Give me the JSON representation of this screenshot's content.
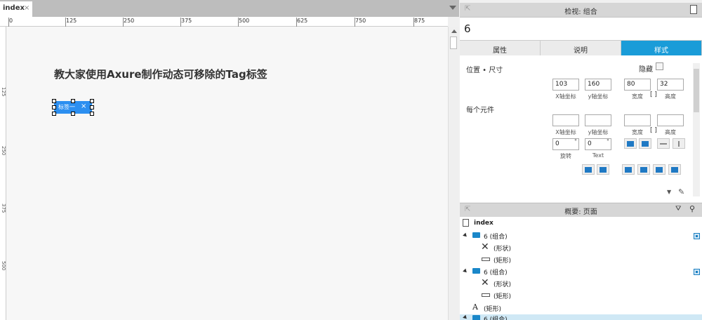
{
  "tab": {
    "name": "index",
    "close": "×"
  },
  "ruler": {
    "h_labels": [
      "0",
      "125",
      "250",
      "375",
      "500",
      "625",
      "750",
      "875"
    ],
    "v_labels": [
      "125",
      "250",
      "375",
      "500"
    ]
  },
  "canvas": {
    "heading": "教大家使用Axure制作动态可移除的Tag标签",
    "tag_label": "标签一",
    "tag_close": "×"
  },
  "inspector": {
    "title": "检视: 组合",
    "name_value": "6",
    "tabs": [
      "属性",
      "说明",
      "样式"
    ],
    "section_position": "位置 • 尺寸",
    "hidden_label": "隐藏",
    "position": {
      "x": "103",
      "y": "160",
      "w": "80",
      "h": "32"
    },
    "labels": {
      "x": "X轴坐标",
      "y": "y轴坐标",
      "w": "宽度",
      "h": "高度",
      "rotate": "旋转",
      "text": "Text"
    },
    "each_element": "每个元件",
    "rotate": {
      "value": "0",
      "text_value": "0",
      "deg": "°"
    }
  },
  "outline": {
    "title": "概要: 页面",
    "rows": [
      {
        "label": "index"
      },
      {
        "label": "6 (组合)"
      },
      {
        "label": "(形状)"
      },
      {
        "label": "(矩形)"
      },
      {
        "label": "6 (组合)"
      },
      {
        "label": "(形状)"
      },
      {
        "label": "(矩形)"
      },
      {
        "label": "(矩形)"
      },
      {
        "label": "6 (组合)"
      }
    ]
  }
}
